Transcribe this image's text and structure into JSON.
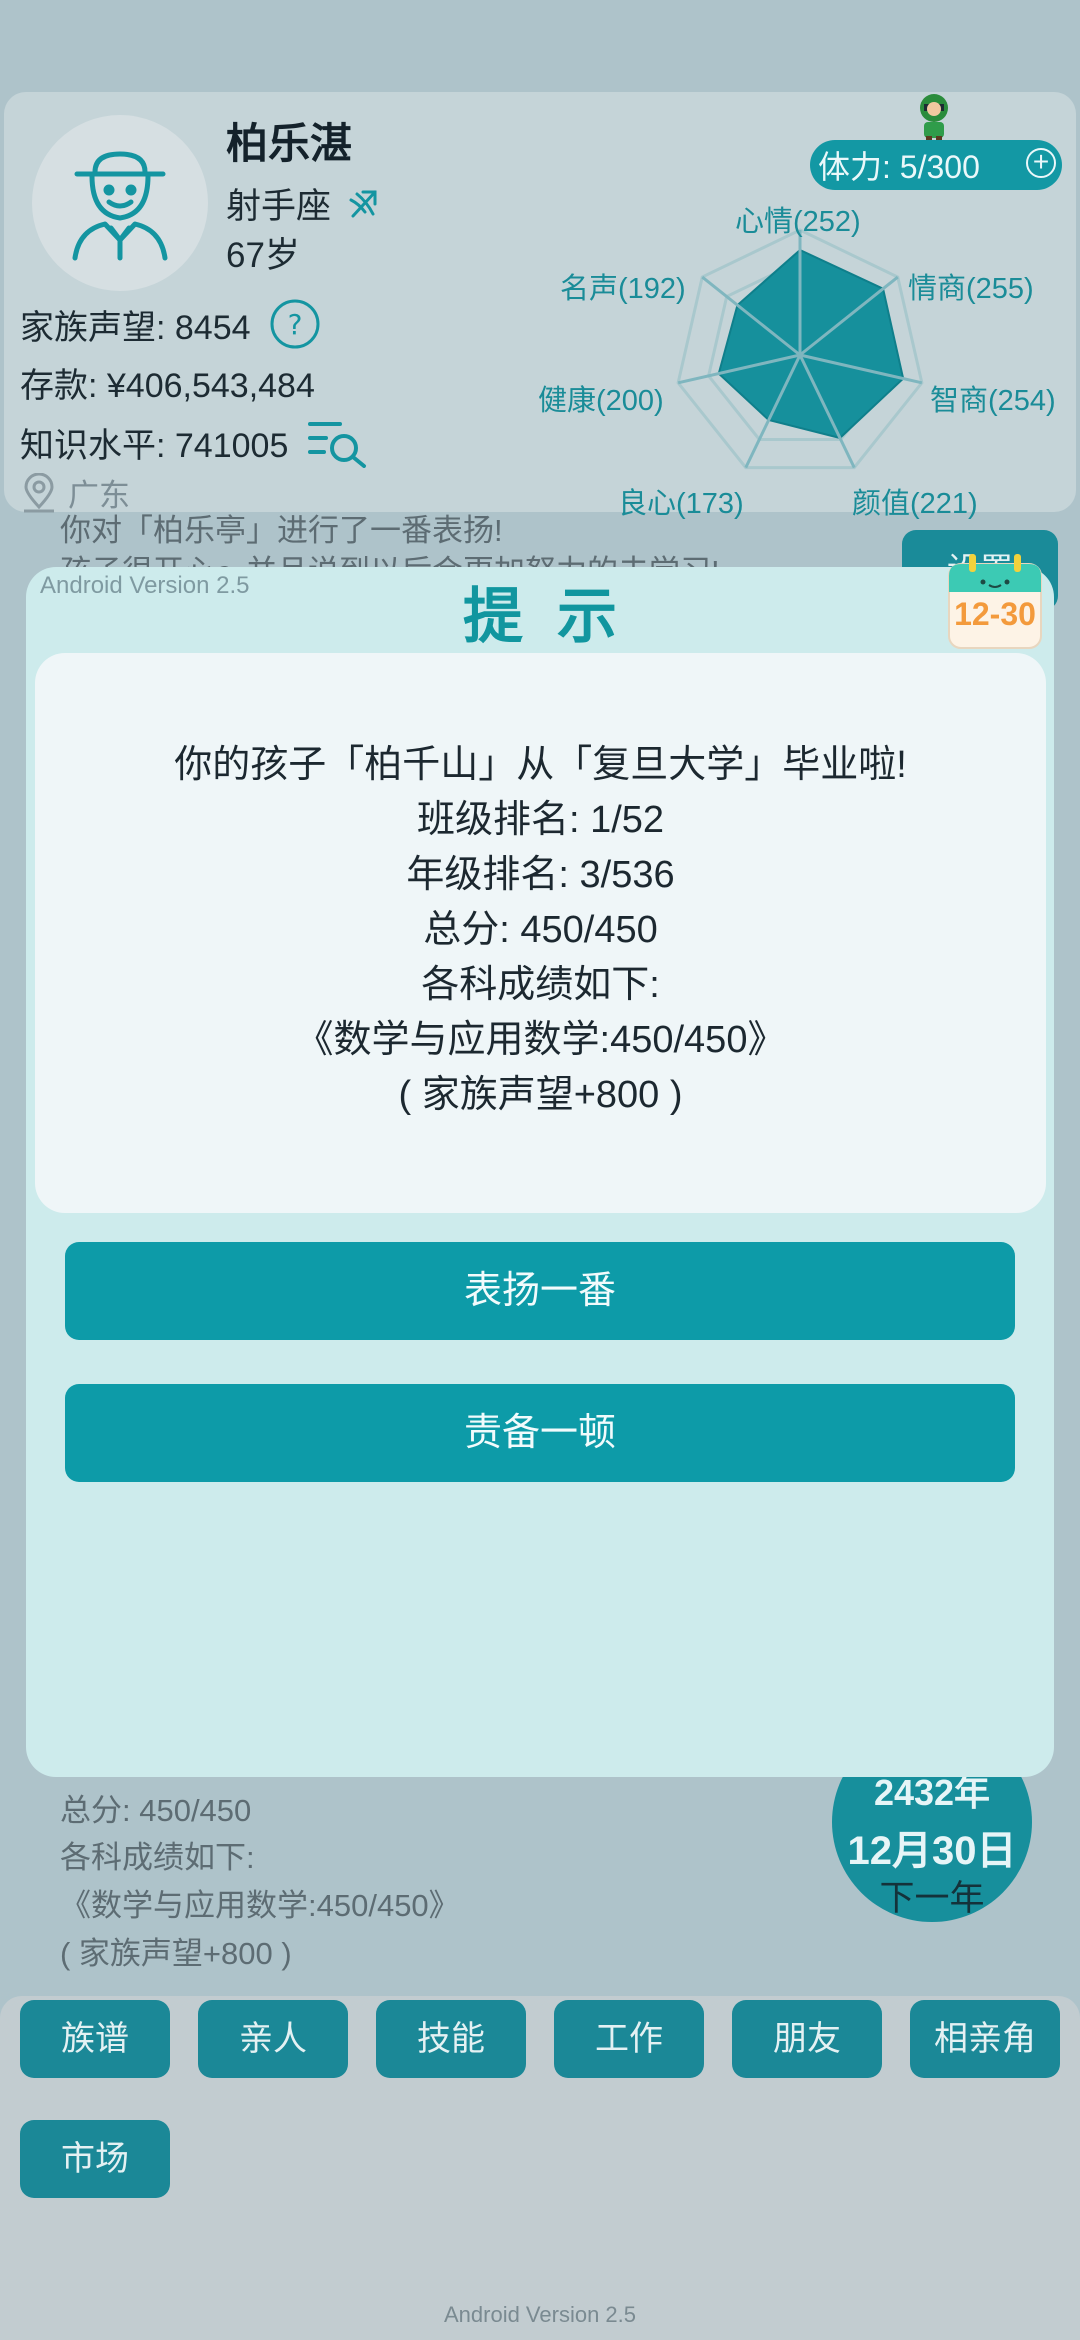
{
  "profile": {
    "name": "柏乐湛",
    "zodiac": "射手座",
    "age": "67岁",
    "reputation": "家族声望: 8454",
    "savings": "存款: ¥406,543,484",
    "knowledge": "知识水平: 741005",
    "location": "广东"
  },
  "stamina": {
    "label": "体力: 5/300",
    "plus": "+"
  },
  "radar": {
    "labels": {
      "mood": "心情(252)",
      "eq": "情商(255)",
      "iq": "智商(254)",
      "looks": "颜值(221)",
      "conscience": "良心(173)",
      "health": "健康(200)",
      "fame": "名声(192)"
    },
    "values": [
      252,
      255,
      254,
      221,
      173,
      200,
      192
    ],
    "max": 300,
    "fill_color": "#16909c"
  },
  "background_log": {
    "line1": "你对「柏乐亭」进行了一番表扬!",
    "line2": "孩子很开心～并且说到以后会更加努力的去学习!",
    "bottom_lines": [
      "总分: 450/450",
      "各科成绩如下:",
      "《数学与应用数学:450/450》",
      "( 家族声望+800 )"
    ]
  },
  "settings_label": "设置",
  "date": {
    "year": "2432年",
    "day": "12月30日",
    "next": "下一年"
  },
  "nav": [
    "族谱",
    "亲人",
    "技能",
    "工作",
    "朋友",
    "相亲角",
    "市场"
  ],
  "footer_version": "Android Version 2.5",
  "dialog": {
    "version": "Android Version 2.5",
    "title": "提示",
    "calendar_date": "12-30",
    "message": [
      "你的孩子「柏千山」从「复旦大学」毕业啦!",
      "班级排名: 1/52",
      "年级排名: 3/536",
      "总分: 450/450",
      "各科成绩如下:",
      "《数学与应用数学:450/450》",
      "( 家族声望+800 )"
    ],
    "praise_button": "表扬一番",
    "scold_button": "责备一顿"
  },
  "colors": {
    "accent": "#0d9ba8",
    "dialog_bg": "#cdebec",
    "calendar_orange": "#f39a3c"
  }
}
